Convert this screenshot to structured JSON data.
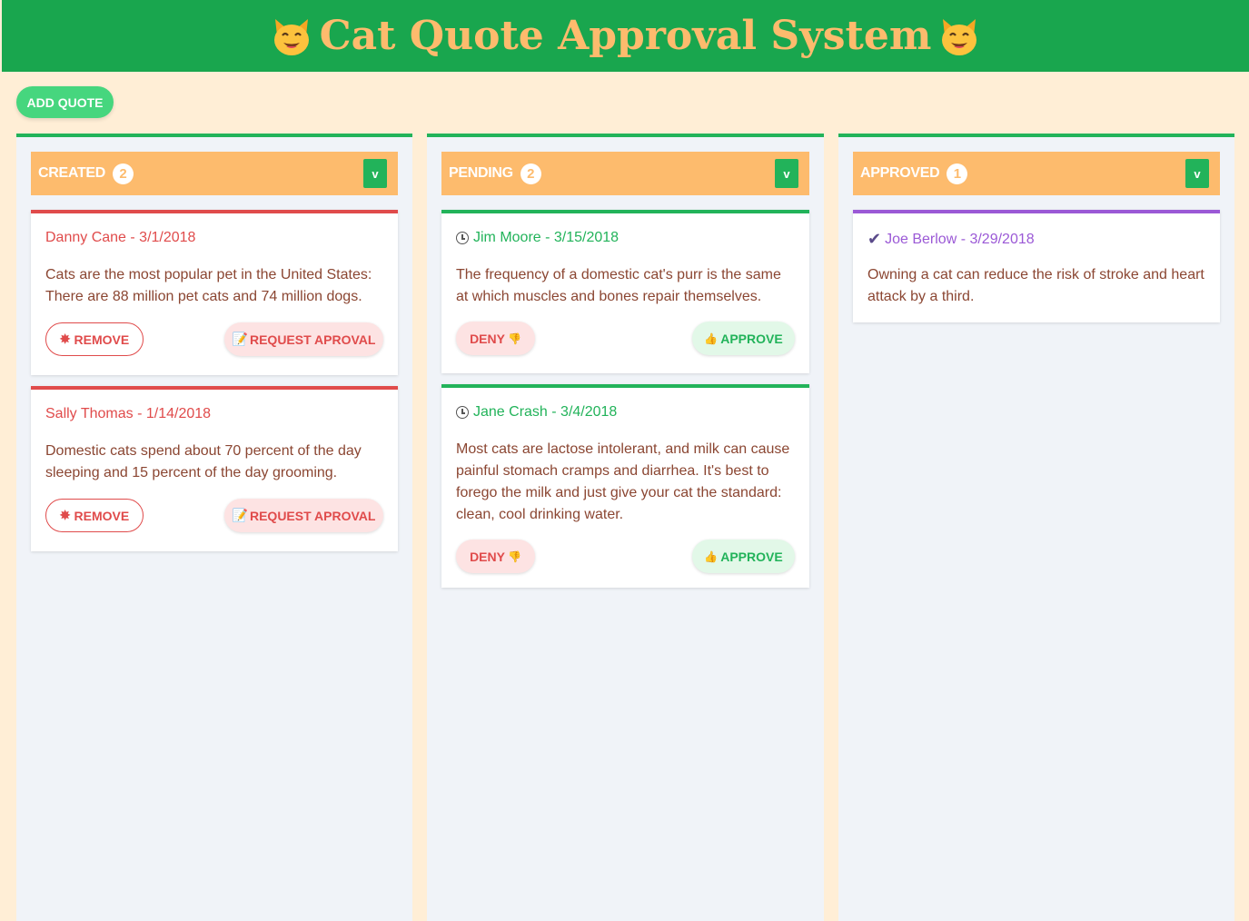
{
  "header": {
    "title": "Cat Quote Approval System",
    "icon": "cat-face-icon"
  },
  "toolbar": {
    "add_label": "ADD QUOTE"
  },
  "colors": {
    "header": "#19a64e",
    "title": "#fdbb6d",
    "created": "#e04b4b",
    "pending": "#22b35a",
    "approved": "#9b59d6"
  },
  "columns": [
    {
      "name": "CREATED",
      "count": "2",
      "toggle": "v",
      "cards": [
        {
          "meta": "Danny Cane - 3/1/2018",
          "text": "Cats are the most popular pet in the United States: There are 88 million pet cats and 74 million dogs.",
          "remove": "REMOVE",
          "request": "REQUEST APROVAL"
        },
        {
          "meta": "Sally Thomas - 1/14/2018",
          "text": "Domestic cats spend about 70 percent of the day sleeping and 15 percent of the day grooming.",
          "remove": "REMOVE",
          "request": "REQUEST APROVAL"
        }
      ]
    },
    {
      "name": "PENDING",
      "count": "2",
      "toggle": "v",
      "cards": [
        {
          "meta": "Jim Moore - 3/15/2018",
          "text": "The frequency of a domestic cat's purr is the same at which muscles and bones repair themselves.",
          "deny": "DENY",
          "approve": "APPROVE"
        },
        {
          "meta": "Jane Crash - 3/4/2018",
          "text": "Most cats are lactose intolerant, and milk can cause painful stomach cramps and diarrhea. It's best to forego the milk and just give your cat the standard: clean, cool drinking water.",
          "deny": "DENY",
          "approve": "APPROVE"
        }
      ]
    },
    {
      "name": "APPROVED",
      "count": "1",
      "toggle": "v",
      "cards": [
        {
          "meta": "Joe Berlow - 3/29/2018",
          "text": "Owning a cat can reduce the risk of stroke and heart attack by a third."
        }
      ]
    }
  ]
}
